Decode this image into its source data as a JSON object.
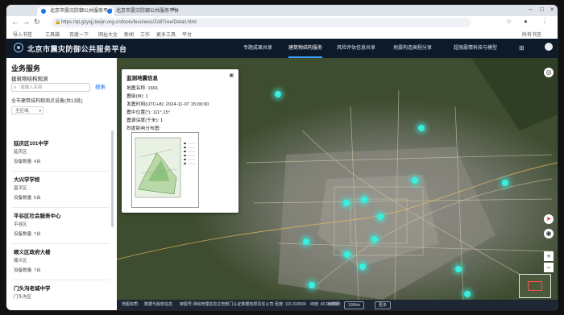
{
  "browser": {
    "tabs": [
      {
        "label": "北京市震灾防御公共服务平台"
      },
      {
        "label": "北京市震灾防御公共服务平台"
      }
    ],
    "new_tab": "+",
    "url": "https://qt.gzyxjj.beijin.org.cn/tools/business/ZcBTree/Detail.html",
    "bookmarks": [
      "导入书签",
      "工具箱",
      "百度一下",
      "网址大全",
      "新闻",
      "工作",
      "更多工具",
      "平台"
    ],
    "right_label": "所有书签"
  },
  "header": {
    "title": "北京市震灾防御公共服务平台",
    "nav": [
      "专题成果共享",
      "建筑物结构服务",
      "风险评估信息共享",
      "地震构造高程分享",
      "超强震情科技与模型"
    ],
    "active_nav_index": 1
  },
  "sidebar": {
    "title": "业务服务",
    "subtitle": "建筑物结构观测",
    "search_placeholder": "请输入名称",
    "search_button": "搜索",
    "count_text": "全市建筑结构观测点设备(共13处)",
    "filter_label": "全区域",
    "cards": [
      {
        "name": "延庆区101中学",
        "district": "延庆区",
        "devices": "设备数量: 4台"
      },
      {
        "name": "大兴学学校",
        "district": "昌平区",
        "devices": "设备数量: 5台"
      },
      {
        "name": "平谷区社会服务中心",
        "district": "平谷区",
        "devices": "设备数量: 7台"
      },
      {
        "name": "顺义区政府大楼",
        "district": "顺义区",
        "devices": "设备数量: 7台"
      },
      {
        "name": "门头沟老城中学",
        "district": "门头沟区",
        "devices": ""
      }
    ]
  },
  "popup": {
    "title": "监测地震信息",
    "rows": [
      "地震名称: 1691",
      "震级(M): 1",
      "发震时刻(UTC+8): 2024-11-07 15:09:00",
      "震中位置(°): 111°,15°",
      "震源深度(千米): 1",
      "烈度影响分布图:"
    ]
  },
  "map": {
    "markers": 15,
    "accent": "#37f0e0",
    "zoom_in": "+",
    "zoom_out": "−"
  },
  "statusbar": {
    "items": [
      "地图资质:",
      "数据与版权信息",
      "审图号:测绘地理信息主管部门认证数据有限责任公司",
      "经度: 116.319504",
      "纬度: 40.043410",
      "比例尺:",
      "100km"
    ],
    "button": "更多"
  }
}
